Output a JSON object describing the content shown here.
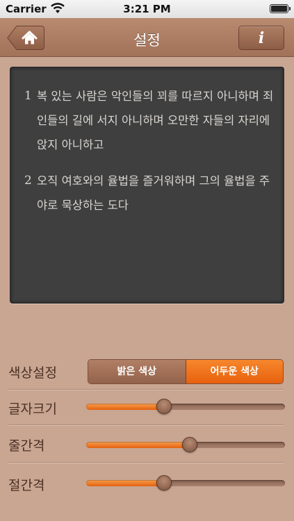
{
  "status_bar": {
    "carrier": "Carrier",
    "time": "3:21 PM",
    "wifi_icon": "wifi-icon",
    "battery_level": 1.0
  },
  "nav": {
    "title": "설정",
    "home_icon": "home-icon",
    "info_label": "i"
  },
  "preview": {
    "verses": [
      {
        "num": "1",
        "text": "복 있는 사람은 악인들의 꾀를 따르지 아니하며 죄인들의 길에 서지 아니하며 오만한 자들의 자리에 앉지 아니하고"
      },
      {
        "num": "2",
        "text": "오직 여호와의 율법을 즐거워하며 그의 율법을 주야로 묵상하는 도다"
      }
    ]
  },
  "settings": {
    "color_label": "색상설정",
    "color_options": [
      "밝은 색상",
      "어두운 색상"
    ],
    "color_selected": "어두운 색상",
    "font_size_label": "글자크기",
    "font_size_value": 0.39,
    "line_spacing_label": "줄간격",
    "line_spacing_value": 0.52,
    "paragraph_spacing_label": "절간격",
    "paragraph_spacing_value": 0.39
  },
  "colors": {
    "background": "#c9a692",
    "navbar": "#a87a60",
    "accent": "#f07a20",
    "panel": "#3f3f3f",
    "panel_text": "#d9d6d2"
  }
}
